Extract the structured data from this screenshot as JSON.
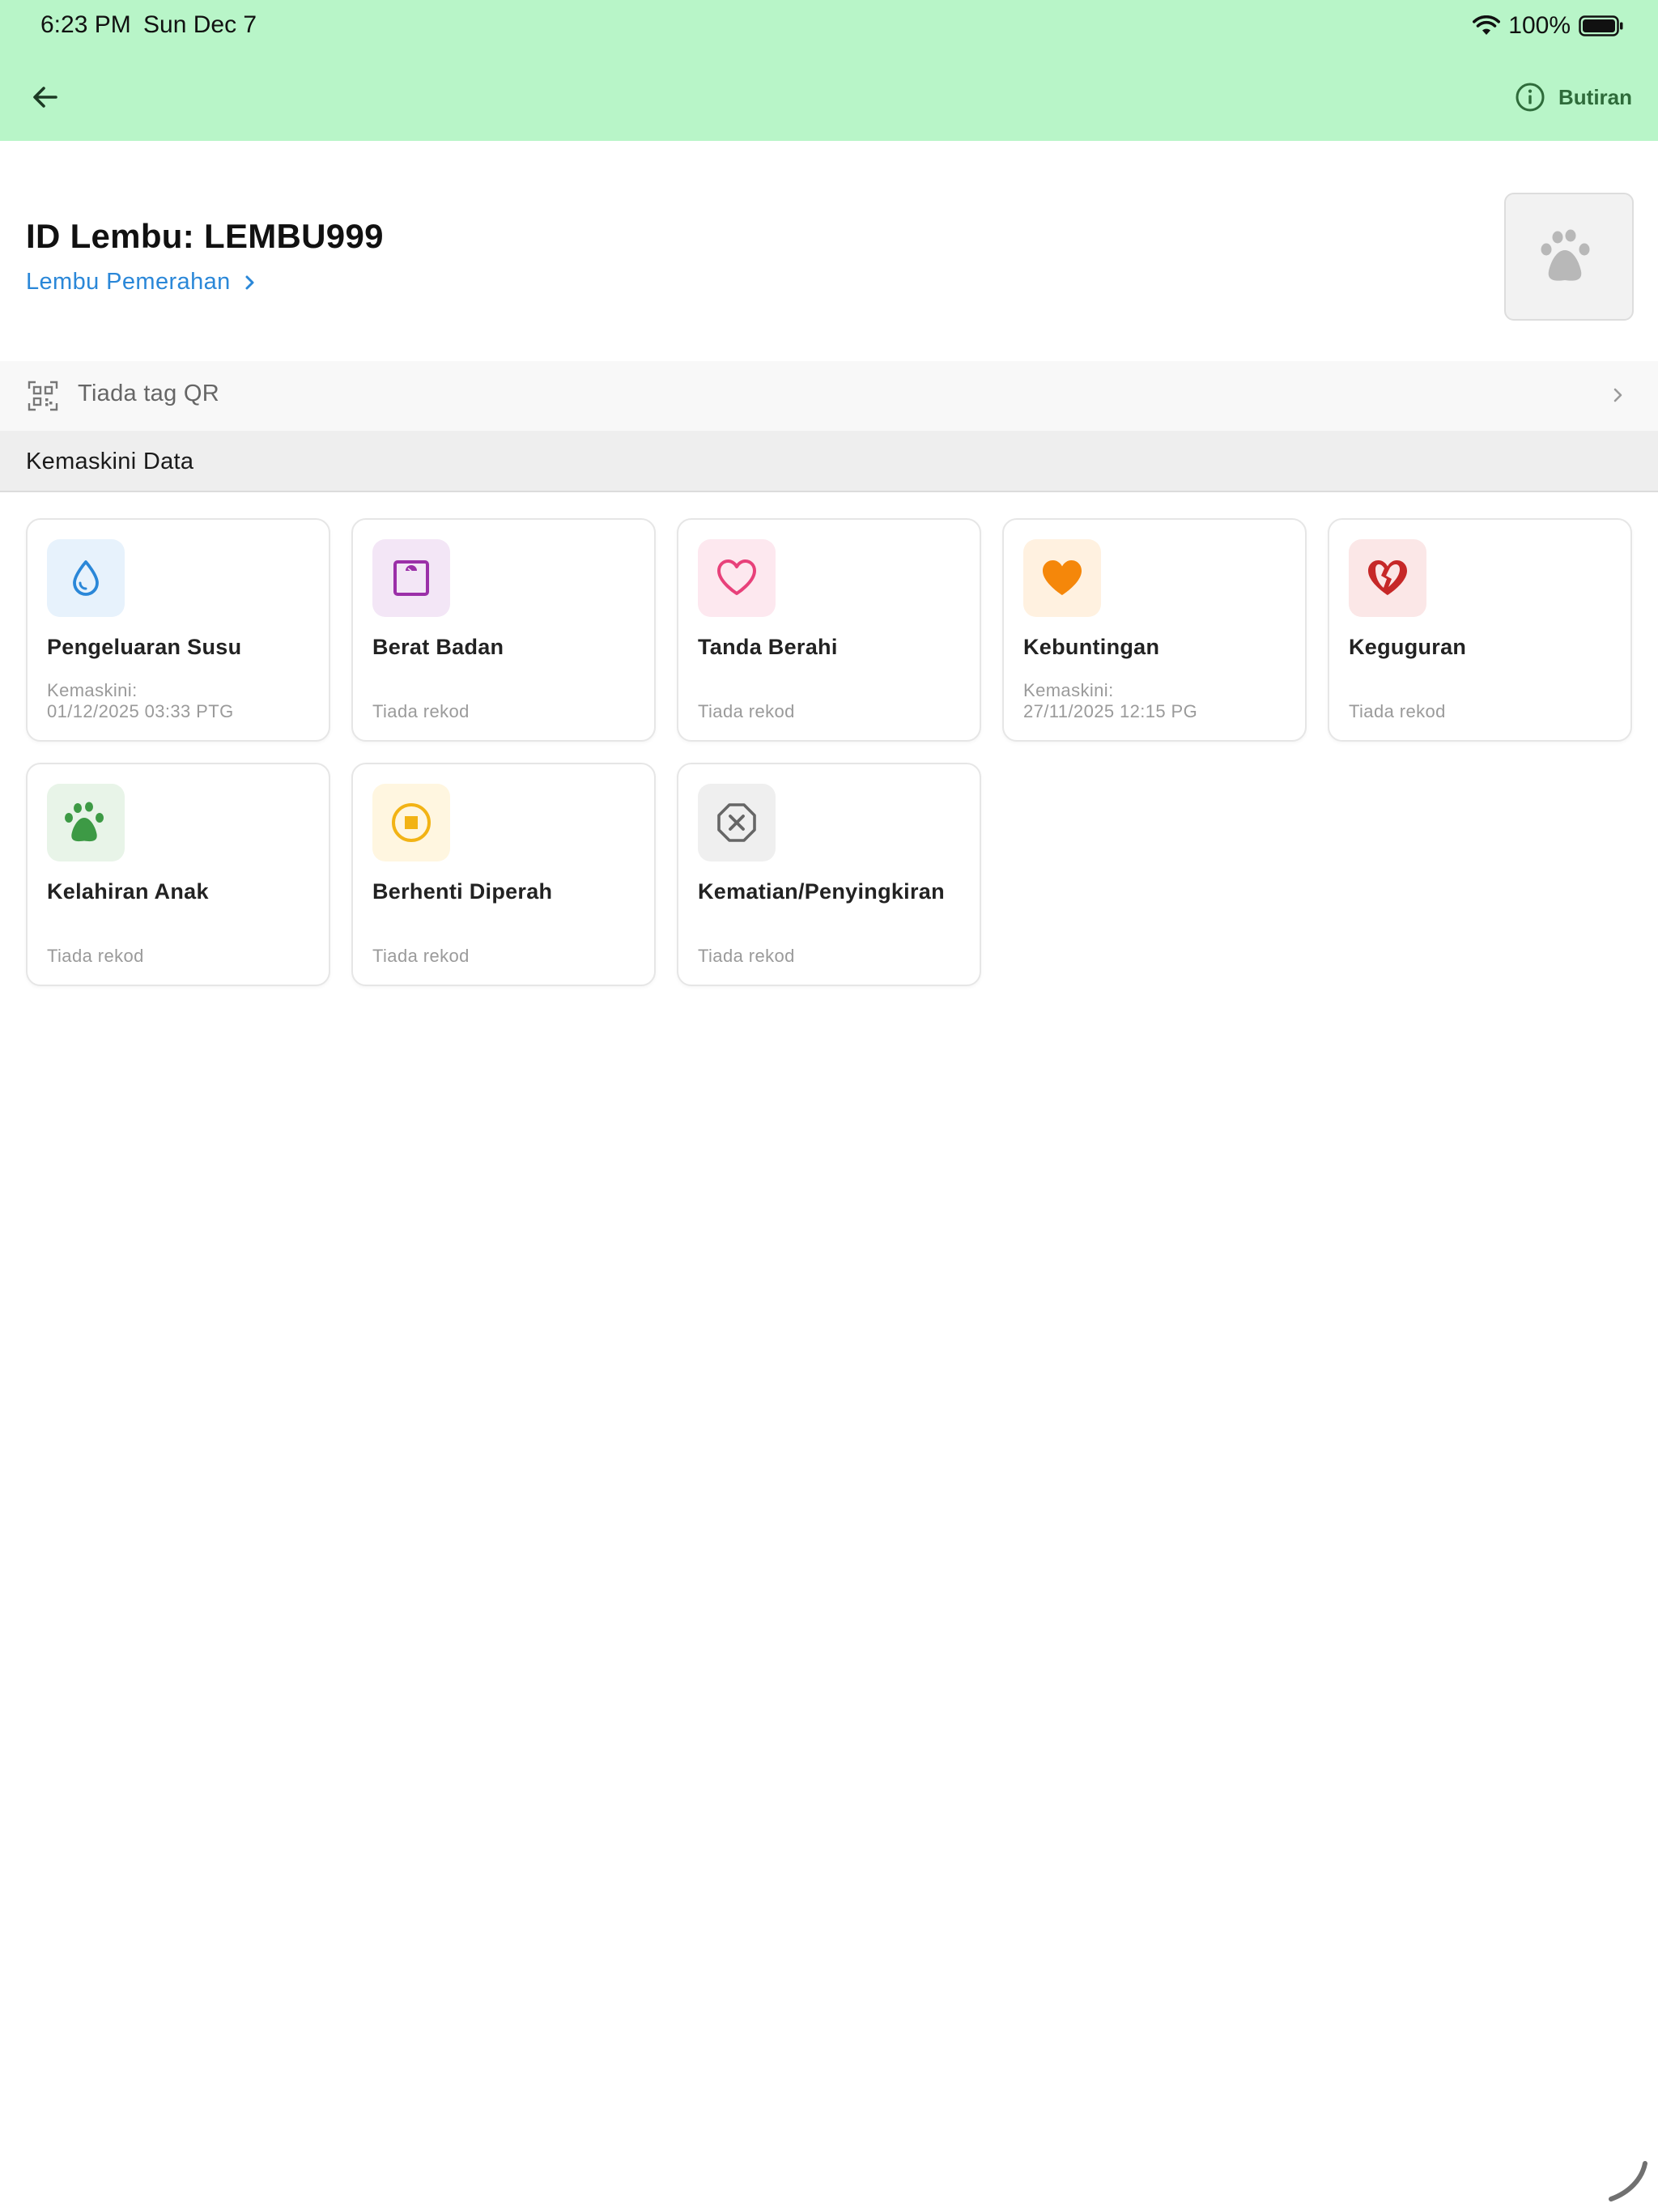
{
  "status_bar": {
    "time": "6:23 PM",
    "date": "Sun Dec 7",
    "battery": "100%"
  },
  "app_bar": {
    "details_label": "Butiran"
  },
  "cow": {
    "id_label": "ID Lembu: LEMBU999",
    "category": "Lembu Pemerahan"
  },
  "qr": {
    "label": "Tiada tag QR"
  },
  "section": {
    "title": "Kemaskini Data"
  },
  "cards": [
    {
      "title": "Pengeluaran Susu",
      "meta_prefix": "Kemaskini:",
      "meta": "01/12/2025 03:33 PTG",
      "icon": "water-drop-icon",
      "color": "#2a87d8",
      "bg": "#e7f2fc"
    },
    {
      "title": "Berat Badan",
      "meta_prefix": "",
      "meta": "Tiada rekod",
      "icon": "scale-icon",
      "color": "#9b2fa8",
      "bg": "#f3e6f6"
    },
    {
      "title": "Tanda Berahi",
      "meta_prefix": "",
      "meta": "Tiada rekod",
      "icon": "heart-outline-icon",
      "color": "#e8417a",
      "bg": "#fde8ef"
    },
    {
      "title": "Kebuntingan",
      "meta_prefix": "Kemaskini:",
      "meta": "27/11/2025 12:15 PG",
      "icon": "heart-filled-icon",
      "color": "#f5870a",
      "bg": "#fff1e0"
    },
    {
      "title": "Keguguran",
      "meta_prefix": "",
      "meta": "Tiada rekod",
      "icon": "broken-heart-icon",
      "color": "#c62828",
      "bg": "#fbe7e7"
    },
    {
      "title": "Kelahiran Anak",
      "meta_prefix": "",
      "meta": "Tiada rekod",
      "icon": "paw-icon",
      "color": "#3d9a45",
      "bg": "#e8f4e8"
    },
    {
      "title": "Berhenti Diperah",
      "meta_prefix": "",
      "meta": "Tiada rekod",
      "icon": "stop-circle-icon",
      "color": "#f2b315",
      "bg": "#fff6e0"
    },
    {
      "title": "Kematian/Penyingkiran",
      "meta_prefix": "",
      "meta": "Tiada rekod",
      "icon": "octagon-x-icon",
      "color": "#666666",
      "bg": "#efefef"
    }
  ]
}
